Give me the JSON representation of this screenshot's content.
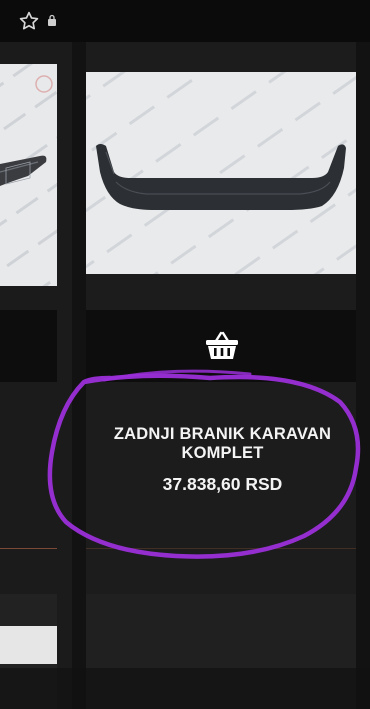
{
  "status_bar": {
    "star_icon": "star-outline-icon",
    "lock_icon": "lock-icon"
  },
  "product": {
    "name": "ZADNJI BRANIK KARAVAN KOMPLET",
    "price": "37.838,60 RSD",
    "image_alt": "rear bumper"
  },
  "icons": {
    "basket": "shopping-basket-icon"
  },
  "colors": {
    "background": "#141414",
    "card": "#1c1c1c",
    "bar": "#0d0d0d",
    "highlight": "#9b2fd9",
    "divider": "#7a4a36"
  }
}
